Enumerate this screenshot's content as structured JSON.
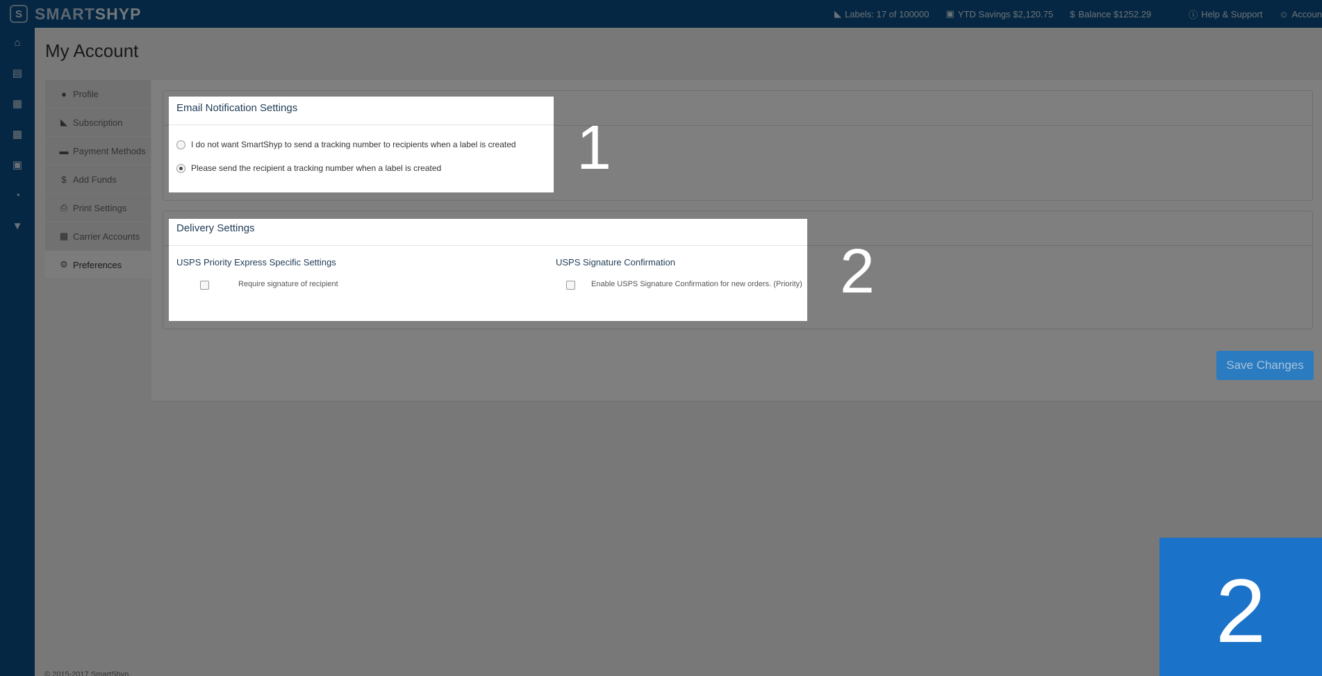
{
  "brand": {
    "name_light": "SMART",
    "name_bold": "SHYP",
    "logo": "S"
  },
  "topbar": {
    "labels": "Labels: 17 of 100000",
    "savings": "YTD Savings $2,120.75",
    "balance": "Balance $1252.29",
    "help": "Help & Support",
    "account": "Accoun"
  },
  "rail_icons": [
    "home-icon",
    "basket-icon",
    "calendar-icon",
    "truck-icon",
    "address-book-icon",
    "pie-chart-icon",
    "cart-icon"
  ],
  "page": {
    "title": "My Account"
  },
  "subnav": {
    "items": [
      {
        "label": "Profile",
        "icon": "user-icon"
      },
      {
        "label": "Subscription",
        "icon": "tag-icon"
      },
      {
        "label": "Payment Methods",
        "icon": "credit-card-icon"
      },
      {
        "label": "Add Funds",
        "icon": "dollar-icon"
      },
      {
        "label": "Print Settings",
        "icon": "printer-icon"
      },
      {
        "label": "Carrier Accounts",
        "icon": "truck-icon"
      },
      {
        "label": "Preferences",
        "icon": "gears-icon",
        "active": true
      }
    ]
  },
  "email_settings": {
    "title": "Email Notification Settings",
    "option_1": "I do not want SmartShyp to send a tracking number to recipients when a label is created",
    "option_2": "Please send the recipient a tracking number when a label is created",
    "selected": 2
  },
  "delivery_settings": {
    "title": "Delivery Settings",
    "col1_title": "USPS Priority Express Specific Settings",
    "col1_option": "Require signature of recipient",
    "col2_title": "USPS Signature Confirmation",
    "col2_option": "Enable USPS Signature Confirmation for new orders. (Priority)"
  },
  "annotations": {
    "marker_1": "1",
    "marker_2": "2",
    "step": "2"
  },
  "save_label": "Save Changes",
  "footer": "© 2015-2017 SmartShyp"
}
